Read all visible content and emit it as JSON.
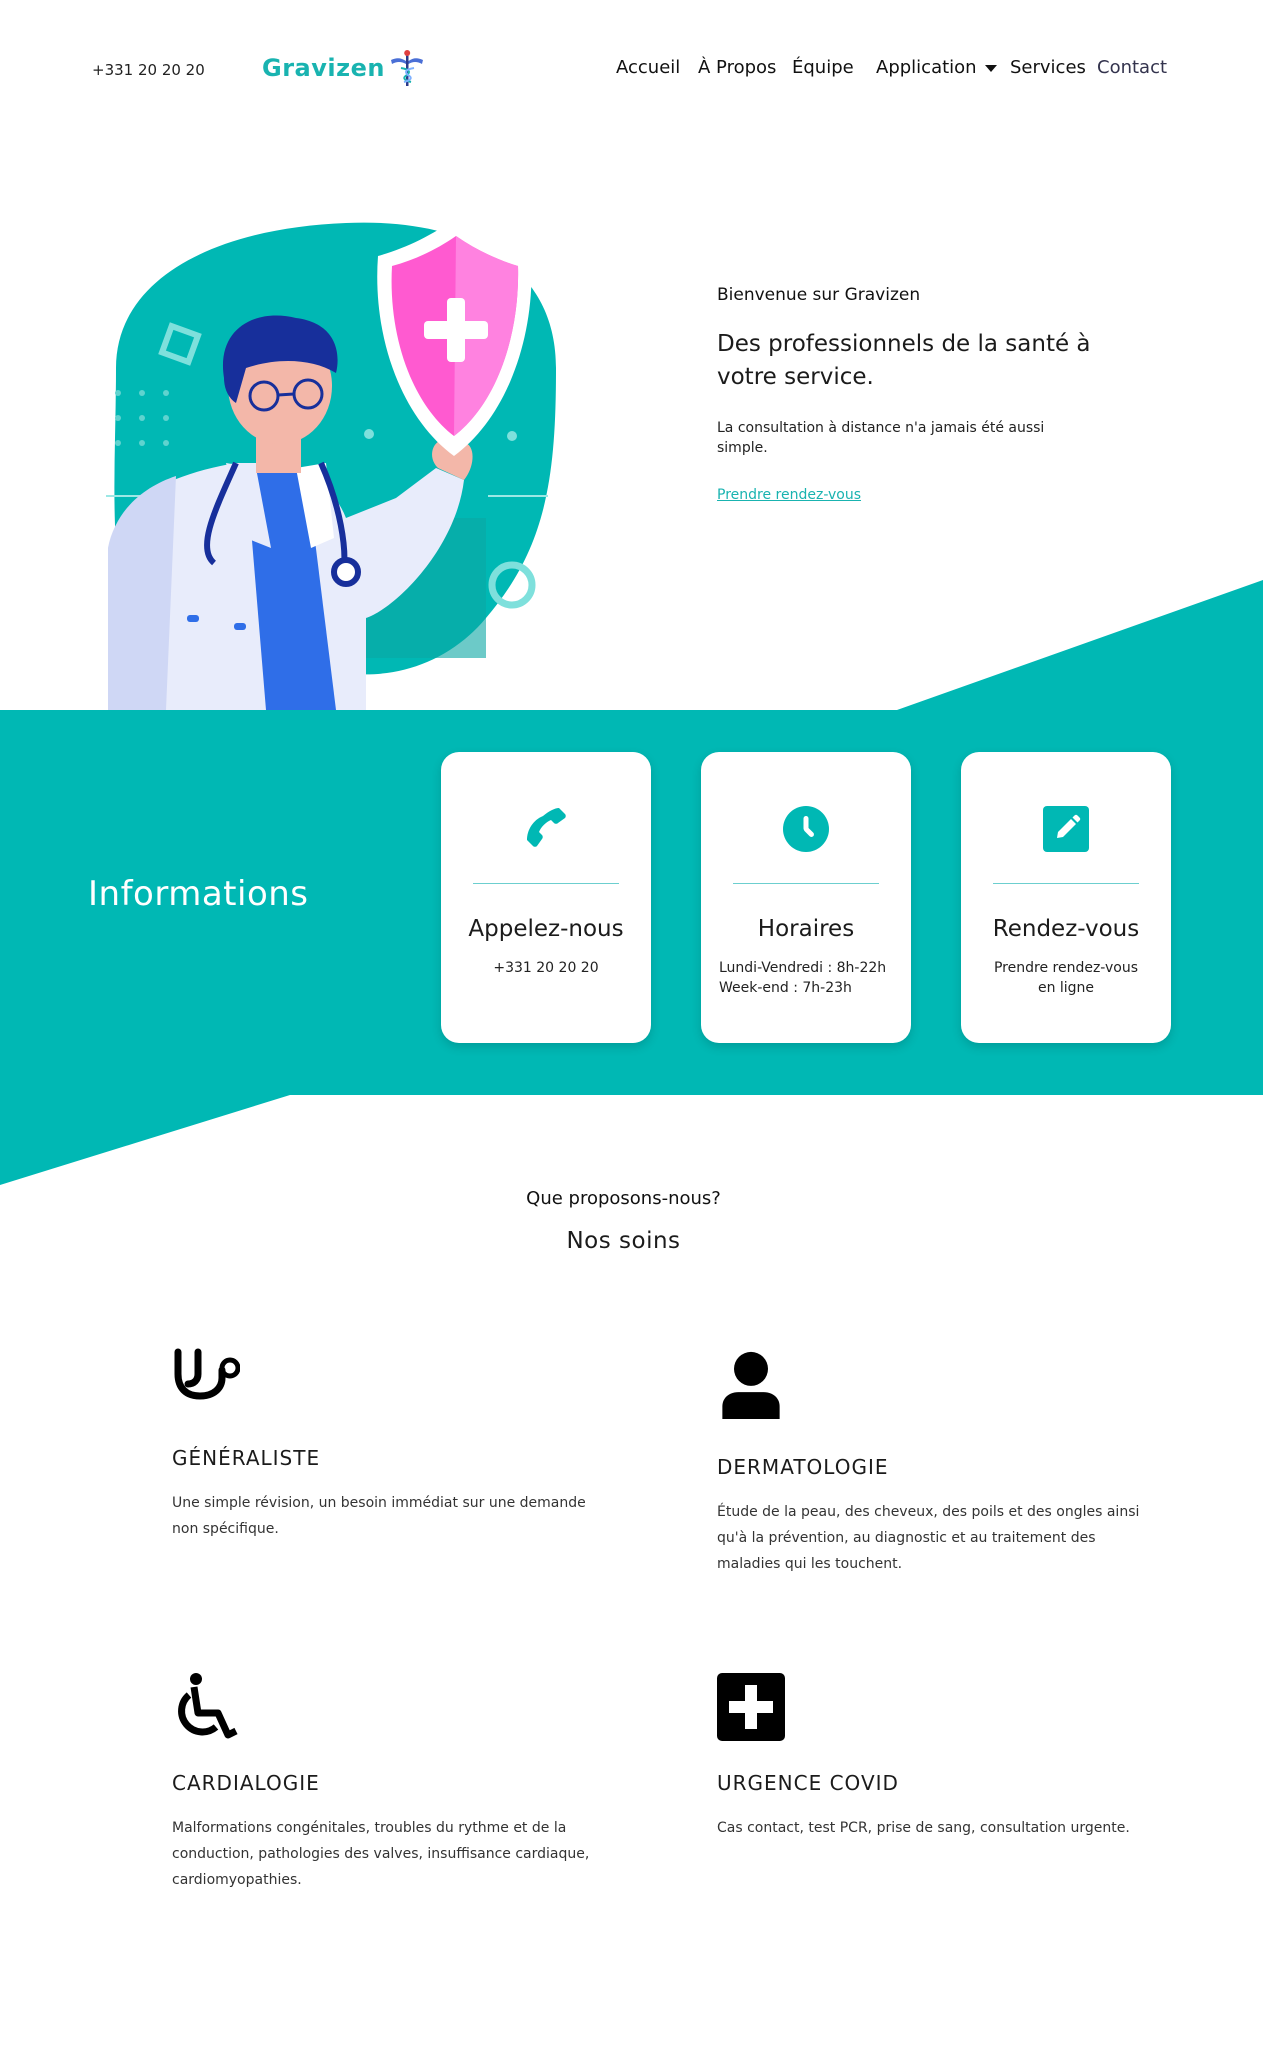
{
  "header": {
    "phone": "+331 20 20 20",
    "logo_text": "Gravizen",
    "nav": {
      "accueil": "Accueil",
      "apropos": "À Propos",
      "equipe": "Équipe",
      "application": "Application",
      "services": "Services",
      "contact": "Contact"
    }
  },
  "hero": {
    "kicker": "Bienvenue sur Gravizen",
    "title": "Des professionnels de la santé à votre service.",
    "subtitle": "La consultation à distance n'a jamais été aussi simple.",
    "cta": "Prendre rendez-vous"
  },
  "info": {
    "heading": "Informations",
    "cards": [
      {
        "icon": "phone-icon",
        "title": "Appelez-nous",
        "text": "+331 20 20 20"
      },
      {
        "icon": "clock-icon",
        "title": "Horaires",
        "text": "Lundi-Vendredi : 8h-22h\nWeek-end : 7h-23h"
      },
      {
        "icon": "edit-icon",
        "title": "Rendez-vous",
        "text": "Prendre rendez-vous en ligne"
      }
    ]
  },
  "services": {
    "kicker": "Que proposons-nous?",
    "title": "Nos soins",
    "items": [
      {
        "icon": "stethoscope-icon",
        "name": "GÉNÉRALISTE",
        "desc": "Une simple révision, un besoin immédiat sur une demande non spécifique."
      },
      {
        "icon": "user-icon",
        "name": "DERMATOLOGIE",
        "desc": "Étude de la peau, des cheveux, des poils et des ongles ainsi qu'à la prévention, au diagnostic et au traitement des maladies qui les touchent."
      },
      {
        "icon": "wheelchair-icon",
        "name": "CARDIALOGIE",
        "desc": "Malformations congénitales, troubles du rythme et de la conduction, pathologies des valves, insuffisance cardiaque, cardiomyopathies."
      },
      {
        "icon": "plus-square-icon",
        "name": "URGENCE COVID",
        "desc": "Cas contact, test PCR, prise de sang, consultation urgente."
      }
    ]
  },
  "colors": {
    "accent": "#00b8b4",
    "accent_dark": "#0aa6a3",
    "logo": "#19b3b0",
    "shield": "#ff5ad0",
    "coat_blue": "#2f6ee8"
  }
}
